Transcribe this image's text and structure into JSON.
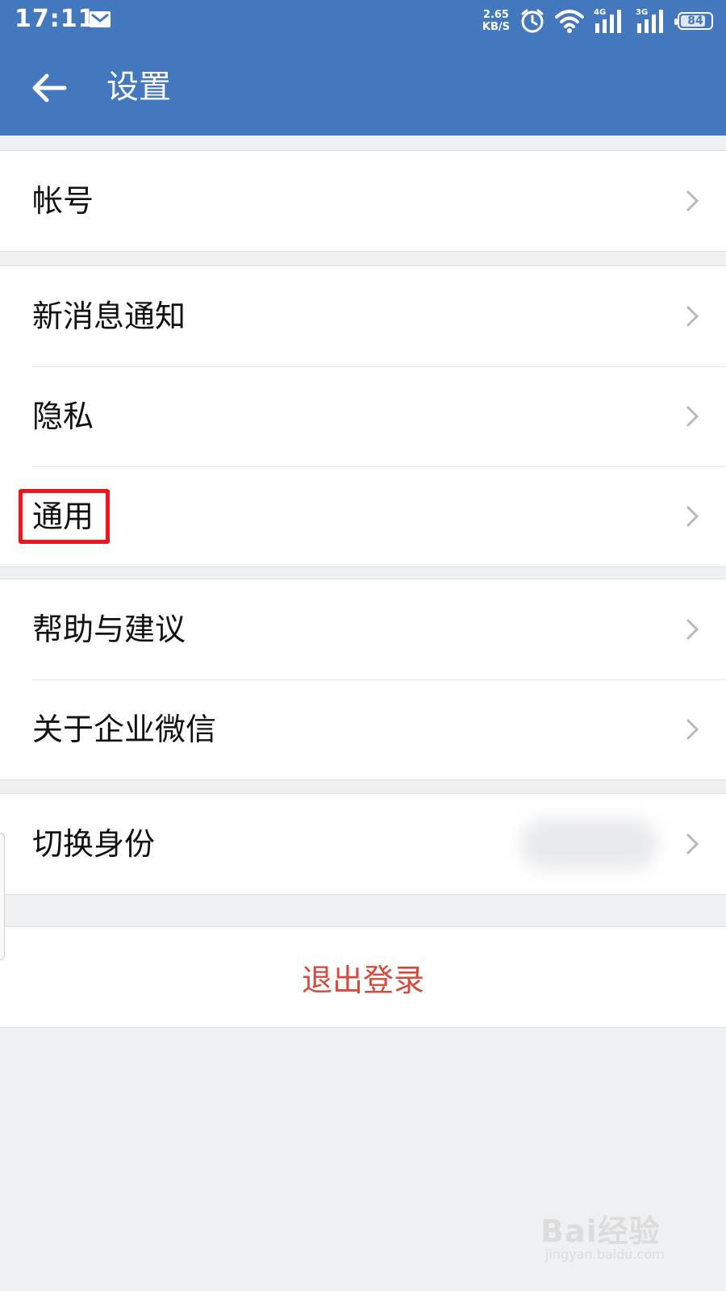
{
  "status_bar": {
    "time": "17:11",
    "net_speed_value": "2.65",
    "net_speed_unit": "KB/S",
    "signal1_label": "4G",
    "signal2_label": "3G",
    "battery_level": "84",
    "icons": [
      "mail-icon",
      "alarm-icon",
      "wifi-icon",
      "signal-icon",
      "battery-icon"
    ]
  },
  "app_bar": {
    "title": "设置",
    "back_icon": "arrow-left-icon"
  },
  "groups": [
    {
      "items": [
        {
          "label": "帐号"
        }
      ]
    },
    {
      "items": [
        {
          "label": "新消息通知"
        },
        {
          "label": "隐私"
        },
        {
          "label": "通用",
          "highlighted": true
        }
      ]
    },
    {
      "items": [
        {
          "label": "帮助与建议"
        },
        {
          "label": "关于企业微信"
        }
      ]
    },
    {
      "items": [
        {
          "label": "切换身份"
        }
      ]
    }
  ],
  "logout": {
    "label": "退出登录"
  },
  "colors": {
    "header": "#4478be",
    "background": "#eff0f2",
    "logout_text": "#d54a3e",
    "highlight_box": "#f2141a"
  },
  "watermark": {
    "main": "Bai经验",
    "sub": "jingyan.baidu.com"
  }
}
